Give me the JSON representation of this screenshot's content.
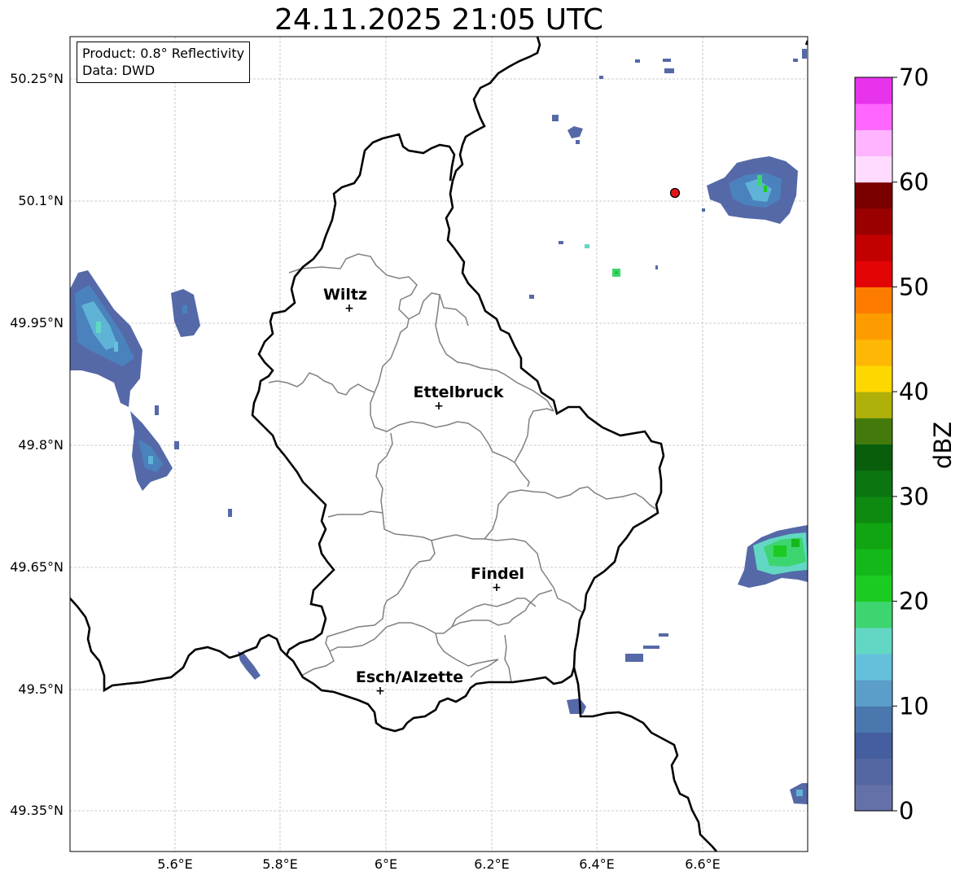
{
  "title": "24.11.2025 21:05 UTC",
  "info": {
    "product": "Product: 0.8° Reflectivity",
    "data_source": "Data: DWD"
  },
  "longitude_ticks": [
    "5.6°E",
    "5.8°E",
    "6°E",
    "6.2°E",
    "6.4°E",
    "6.6°E"
  ],
  "latitude_ticks": [
    "50.25°N",
    "50.1°N",
    "49.95°N",
    "49.8°N",
    "49.65°N",
    "49.5°N",
    "49.35°N"
  ],
  "cities": [
    {
      "name": "Wiltz"
    },
    {
      "name": "Ettelbruck"
    },
    {
      "name": "Findel"
    },
    {
      "name": "Esch/Alzette"
    }
  ],
  "colorbar": {
    "label": "dBZ",
    "ticks": [
      "0",
      "10",
      "20",
      "30",
      "40",
      "50",
      "60",
      "70"
    ],
    "min": 0,
    "max": 70,
    "step": 2.5,
    "colors": [
      "#6371a8",
      "#5467a2",
      "#445e9f",
      "#4a77ae",
      "#5a9ec9",
      "#65c0dc",
      "#62d7c3",
      "#3dd56f",
      "#1ccb21",
      "#14b81a",
      "#11a413",
      "#0e8a10",
      "#0b7510",
      "#085e0a",
      "#447a0c",
      "#b0b00a",
      "#fed700",
      "#fdb704",
      "#fd9c00",
      "#fd7c00",
      "#e20404",
      "#c20000",
      "#9b0000",
      "#7a0000",
      "#ffdcff",
      "#ffb4ff",
      "#ff66ff",
      "#e734ec"
    ]
  },
  "colors": {
    "border_national": "#000000",
    "border_cantonal": "#808080",
    "grid": "#bdbdbd",
    "radar_marker": "#e31414"
  }
}
